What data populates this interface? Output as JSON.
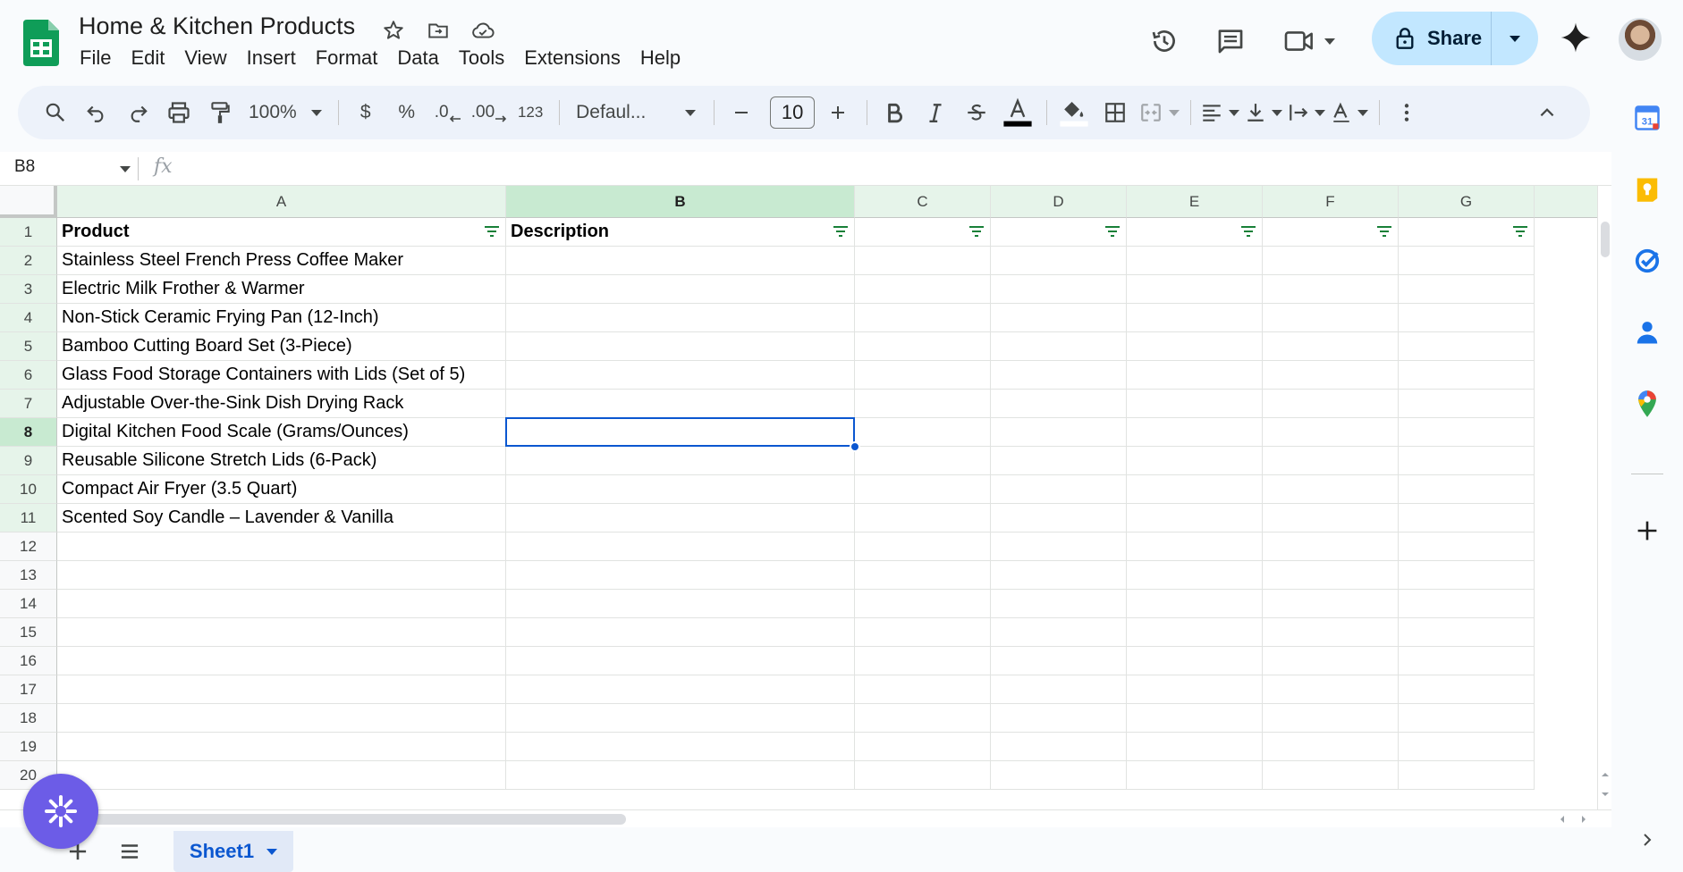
{
  "doc": {
    "title": "Home & Kitchen Products"
  },
  "menu": [
    "File",
    "Edit",
    "View",
    "Insert",
    "Format",
    "Data",
    "Tools",
    "Extensions",
    "Help"
  ],
  "share": {
    "label": "Share"
  },
  "toolbar": {
    "zoom": "100%",
    "currency": "$",
    "percent": "%",
    "dec_decrease": ".0",
    "dec_increase": ".00",
    "number_format": "123",
    "font": "Defaul...",
    "font_size": "10"
  },
  "formula_bar": {
    "name_box": "B8",
    "fx": "fx",
    "value": ""
  },
  "columns": [
    "A",
    "B",
    "C",
    "D",
    "E",
    "F",
    "G"
  ],
  "rows": [
    "1",
    "2",
    "3",
    "4",
    "5",
    "6",
    "7",
    "8",
    "9",
    "10",
    "11",
    "12",
    "13",
    "14",
    "15",
    "16",
    "17",
    "18",
    "19",
    "20"
  ],
  "cells": {
    "A": [
      "Product",
      "Stainless Steel French Press Coffee Maker",
      "Electric Milk Frother & Warmer",
      "Non-Stick Ceramic Frying Pan (12-Inch)",
      "Bamboo Cutting Board Set (3-Piece)",
      "Glass Food Storage Containers with Lids (Set of 5)",
      "Adjustable Over-the-Sink Dish Drying Rack",
      "Digital Kitchen Food Scale (Grams/Ounces)",
      "Reusable Silicone Stretch Lids (6-Pack)",
      "Compact Air Fryer (3.5 Quart)",
      "Scented Soy Candle – Lavender & Vanilla"
    ],
    "B": [
      "Description"
    ]
  },
  "selection": {
    "cell": "B8"
  },
  "sheet_tab": {
    "label": "Sheet1"
  },
  "colors": {
    "accent": "#0b57d0",
    "share_bg": "#c2e7ff",
    "filter_header": "#e6f4ea",
    "sheets_green": "#0f9d58"
  }
}
